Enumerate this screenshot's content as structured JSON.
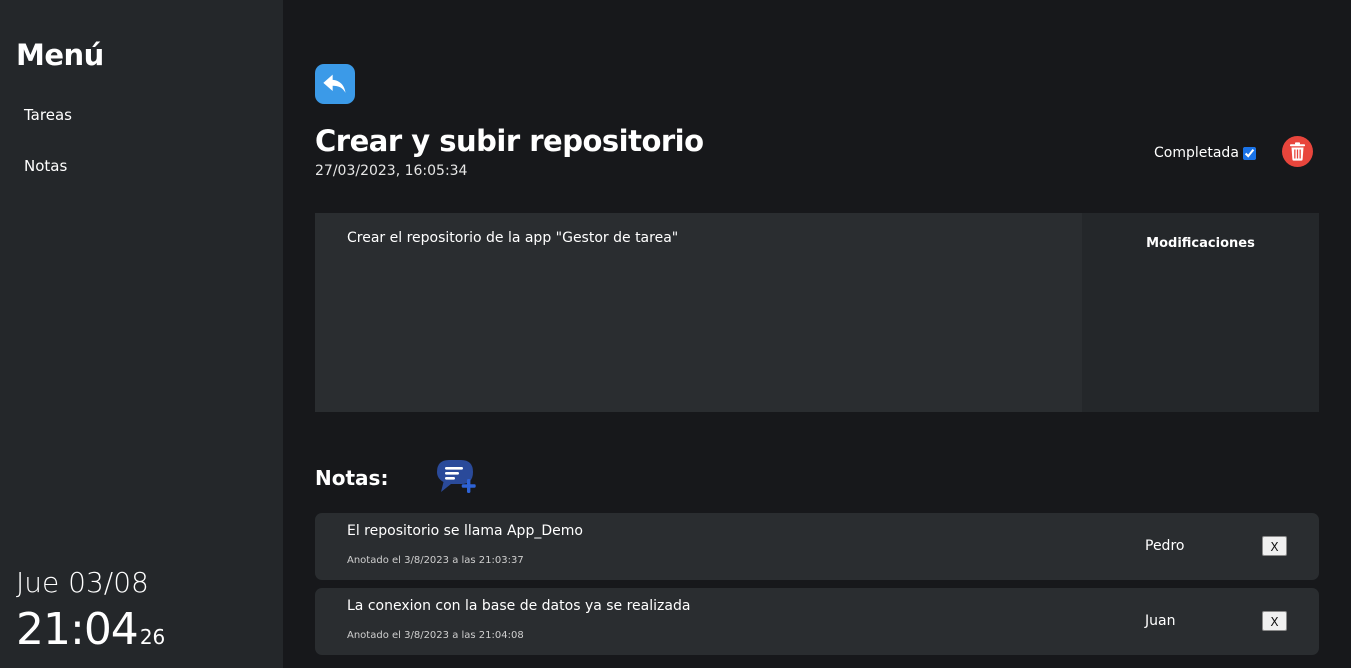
{
  "sidebar": {
    "title": "Menú",
    "items": [
      {
        "label": "Tareas"
      },
      {
        "label": "Notas"
      }
    ],
    "clock": {
      "date": "Jue 03/08",
      "time": "21:04",
      "seconds": "26"
    }
  },
  "task": {
    "title": "Crear y subir repositorio",
    "date": "27/03/2023, 16:05:34",
    "completed_label": "Completada",
    "completed": true,
    "description": "Crear el repositorio de la app \"Gestor de tarea\"",
    "modifications_title": "Modificaciones"
  },
  "notes": {
    "heading": "Notas:",
    "items": [
      {
        "text": "El repositorio se llama App_Demo",
        "meta": "Anotado el 3/8/2023 a las 21:03:37",
        "author": "Pedro",
        "remove_label": "X"
      },
      {
        "text": "La conexion con la base de datos ya se realizada",
        "meta": "Anotado el 3/8/2023 a las 21:04:08",
        "author": "Juan",
        "remove_label": "X"
      }
    ]
  },
  "icons": {
    "back": "reply-arrow-icon",
    "delete": "trash-icon",
    "add_note": "add-comment-icon"
  },
  "colors": {
    "background": "#17181b",
    "sidebar": "#24272a",
    "panel": "#2a2d30",
    "accent_blue": "#3b9ae8",
    "danger_red": "#e8453c",
    "add_note_blue": "#2e63d6"
  }
}
